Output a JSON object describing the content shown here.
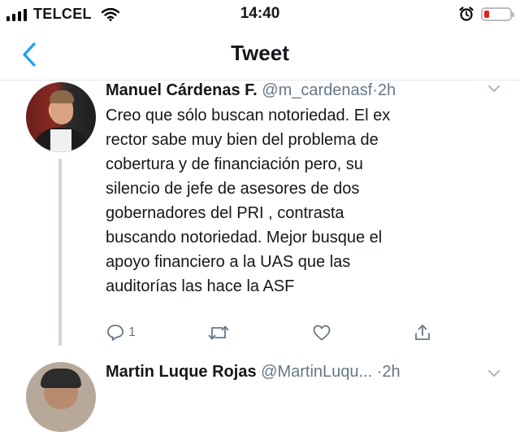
{
  "status_bar": {
    "carrier": "TELCEL",
    "time": "14:40",
    "signal_icon": "signal-bars-icon",
    "wifi_icon": "wifi-icon",
    "alarm_icon": "alarm-clock-icon",
    "battery_icon": "battery-low-icon",
    "battery_color": "#e0221c"
  },
  "nav": {
    "title": "Tweet",
    "back_icon": "chevron-left-icon",
    "accent": "#1da1f2"
  },
  "tweets": [
    {
      "name": "Manuel Cárdenas F.",
      "handle": "@m_cardenasf",
      "separator": "·",
      "time": "2h",
      "text": "Creo que sólo buscan notoriedad. El ex\nrector sabe muy bien del problema de\ncobertura y de financiación pero, su\nsilencio de jefe de asesores de dos\ngobernadores del PRI , contrasta\nbuscando notoriedad. Mejor busque el\napoyo financiero a la UAS que las\nauditorías las hace la ASF",
      "reply_count": "1"
    },
    {
      "name": "Martin Luque Rojas",
      "handle": "@MartinLuqu...",
      "separator": "·",
      "time": "2h"
    }
  ]
}
